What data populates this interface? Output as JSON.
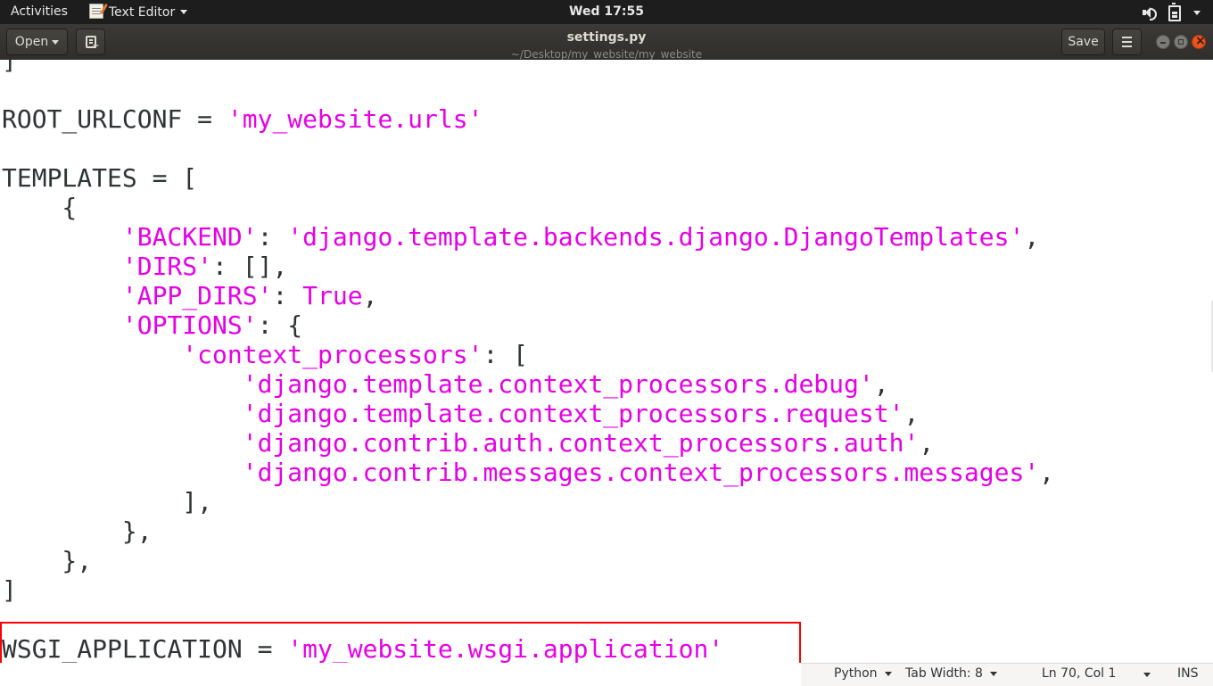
{
  "topbar": {
    "activities": "Activities",
    "app_name": "Text Editor",
    "clock": "Wed 17:55",
    "icons": [
      "speaker-icon",
      "battery-icon",
      "system-menu-arrow-icon"
    ]
  },
  "headerbar": {
    "open_label": "Open",
    "title": "settings.py",
    "subtitle": "~/Desktop/my_website/my_website",
    "save_label": "Save",
    "icons": [
      "new-tab-icon",
      "hamburger-menu-icon",
      "minimize-icon",
      "maximize-icon",
      "close-icon"
    ]
  },
  "editor": {
    "colors": {
      "text": "#2e3436",
      "string": "#e600e6",
      "highlight_box": "#ff0000"
    },
    "lines": [
      [
        {
          "t": "]",
          "s": false
        }
      ],
      [],
      [
        {
          "t": "ROOT_URLCONF = ",
          "s": false
        },
        {
          "t": "'my_website.urls'",
          "s": true
        }
      ],
      [],
      [
        {
          "t": "TEMPLATES = [",
          "s": false
        }
      ],
      [
        {
          "t": "    {",
          "s": false
        }
      ],
      [
        {
          "t": "        ",
          "s": false
        },
        {
          "t": "'BACKEND'",
          "s": true
        },
        {
          "t": ": ",
          "s": false
        },
        {
          "t": "'django.template.backends.django.DjangoTemplates'",
          "s": true
        },
        {
          "t": ",",
          "s": false
        }
      ],
      [
        {
          "t": "        ",
          "s": false
        },
        {
          "t": "'DIRS'",
          "s": true
        },
        {
          "t": ": [],",
          "s": false
        }
      ],
      [
        {
          "t": "        ",
          "s": false
        },
        {
          "t": "'APP_DIRS'",
          "s": true
        },
        {
          "t": ": ",
          "s": false
        },
        {
          "t": "True",
          "s": true
        },
        {
          "t": ",",
          "s": false
        }
      ],
      [
        {
          "t": "        ",
          "s": false
        },
        {
          "t": "'OPTIONS'",
          "s": true
        },
        {
          "t": ": {",
          "s": false
        }
      ],
      [
        {
          "t": "            ",
          "s": false
        },
        {
          "t": "'context_processors'",
          "s": true
        },
        {
          "t": ": [",
          "s": false
        }
      ],
      [
        {
          "t": "                ",
          "s": false
        },
        {
          "t": "'django.template.context_processors.debug'",
          "s": true
        },
        {
          "t": ",",
          "s": false
        }
      ],
      [
        {
          "t": "                ",
          "s": false
        },
        {
          "t": "'django.template.context_processors.request'",
          "s": true
        },
        {
          "t": ",",
          "s": false
        }
      ],
      [
        {
          "t": "                ",
          "s": false
        },
        {
          "t": "'django.contrib.auth.context_processors.auth'",
          "s": true
        },
        {
          "t": ",",
          "s": false
        }
      ],
      [
        {
          "t": "                ",
          "s": false
        },
        {
          "t": "'django.contrib.messages.context_processors.messages'",
          "s": true
        },
        {
          "t": ",",
          "s": false
        }
      ],
      [
        {
          "t": "            ],",
          "s": false
        }
      ],
      [
        {
          "t": "        },",
          "s": false
        }
      ],
      [
        {
          "t": "    },",
          "s": false
        }
      ],
      [
        {
          "t": "]",
          "s": false
        }
      ],
      [],
      [
        {
          "t": "WSGI_APPLICATION = ",
          "s": false
        },
        {
          "t": "'my_website.wsgi.application'",
          "s": true
        }
      ]
    ]
  },
  "statusbar": {
    "language": "Python",
    "tab_width": "Tab Width: 8",
    "position": "Ln 70, Col 1",
    "mode": "INS"
  }
}
